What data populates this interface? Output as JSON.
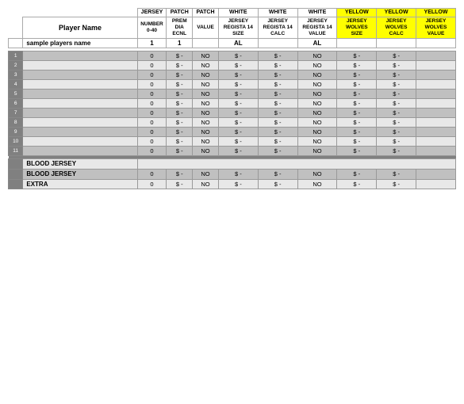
{
  "table": {
    "headers": {
      "row1": [
        "",
        "JERSEY",
        "PATCH",
        "PATCH",
        "WHITE",
        "WHITE",
        "WHITE",
        "YELLOW",
        "YELLOW",
        "YELLOW"
      ],
      "row2": [
        "Player Name",
        "NUMBER\n0-40",
        "PREM\nDIA\nECNL",
        "",
        "JERSEY\nREGISTA 14\nSIZE",
        "JERSEY\nREGISTA 14\nCALC",
        "JERSEY\nREGISTA 14\nVALUE",
        "JERSEY\nWOLVES\nSIZE",
        "JERSEY\nWOLVES\nCALC",
        "JERSEY\nWOLVES\nVALUE"
      ],
      "subrow": [
        "",
        "",
        "VALUE",
        "",
        "",
        "",
        "",
        "",
        "",
        ""
      ]
    },
    "sample_row": {
      "name": "sample players name",
      "num": "1",
      "patch1": "1",
      "patch2": "",
      "w1": "AL",
      "w2": "",
      "w3": "AL",
      "y1": "",
      "y2": "",
      "y3": ""
    },
    "data_rows": [
      {
        "num": "0",
        "w1": "$ -",
        "no1": "NO",
        "w2": "$ -",
        "w3": "$ -",
        "no2": "NO",
        "y1": "$ -",
        "y2": "$ -"
      },
      {
        "num": "0",
        "w1": "$ -",
        "no1": "NO",
        "w2": "$ -",
        "w3": "$ -",
        "no2": "NO",
        "y1": "$ -",
        "y2": "$ -"
      },
      {
        "num": "0",
        "w1": "$ -",
        "no1": "NO",
        "w2": "$ -",
        "w3": "$ -",
        "no2": "NO",
        "y1": "$ -",
        "y2": "$ -"
      },
      {
        "num": "0",
        "w1": "$ -",
        "no1": "NO",
        "w2": "$ -",
        "w3": "$ -",
        "no2": "NO",
        "y1": "$ -",
        "y2": "$ -"
      },
      {
        "num": "0",
        "w1": "$ -",
        "no1": "NO",
        "w2": "$ -",
        "w3": "$ -",
        "no2": "NO",
        "y1": "$ -",
        "y2": "$ -"
      },
      {
        "num": "0",
        "w1": "$ -",
        "no1": "NO",
        "w2": "$ -",
        "w3": "$ -",
        "no2": "NO",
        "y1": "$ -",
        "y2": "$ -"
      },
      {
        "num": "0",
        "w1": "$ -",
        "no1": "NO",
        "w2": "$ -",
        "w3": "$ -",
        "no2": "NO",
        "y1": "$ -",
        "y2": "$ -"
      },
      {
        "num": "0",
        "w1": "$ -",
        "no1": "NO",
        "w2": "$ -",
        "w3": "$ -",
        "no2": "NO",
        "y1": "$ -",
        "y2": "$ -"
      },
      {
        "num": "0",
        "w1": "$ -",
        "no1": "NO",
        "w2": "$ -",
        "w3": "$ -",
        "no2": "NO",
        "y1": "$ -",
        "y2": "$ -"
      },
      {
        "num": "0",
        "w1": "$ -",
        "no1": "NO",
        "w2": "$ -",
        "w3": "$ -",
        "no2": "NO",
        "y1": "$ -",
        "y2": "$ -"
      },
      {
        "num": "0",
        "w1": "$ -",
        "no1": "NO",
        "w2": "$ -",
        "w3": "$ -",
        "no2": "NO",
        "y1": "$ -",
        "y2": "$ -"
      }
    ],
    "special_rows": [
      {
        "label": "BLOOD JERSEY",
        "num": "",
        "w1": "",
        "no1": "",
        "w2": "",
        "w3": "",
        "no2": "",
        "y1": "",
        "y2": ""
      },
      {
        "label": "BLOOD JERSEY",
        "num": "0",
        "w1": "$ -",
        "no1": "NO",
        "w2": "$ -",
        "w3": "$ -",
        "no2": "NO",
        "y1": "$ -",
        "y2": "$ -"
      },
      {
        "label": "EXTRA",
        "num": "0",
        "w1": "$ -",
        "no1": "NO",
        "w2": "$ -",
        "w3": "$ -",
        "no2": "NO",
        "y1": "$ -",
        "y2": "$ -"
      }
    ],
    "row_numbers": [
      "1",
      "2",
      "3",
      "4",
      "5",
      "6",
      "7",
      "8",
      "9",
      "10",
      "11"
    ]
  }
}
